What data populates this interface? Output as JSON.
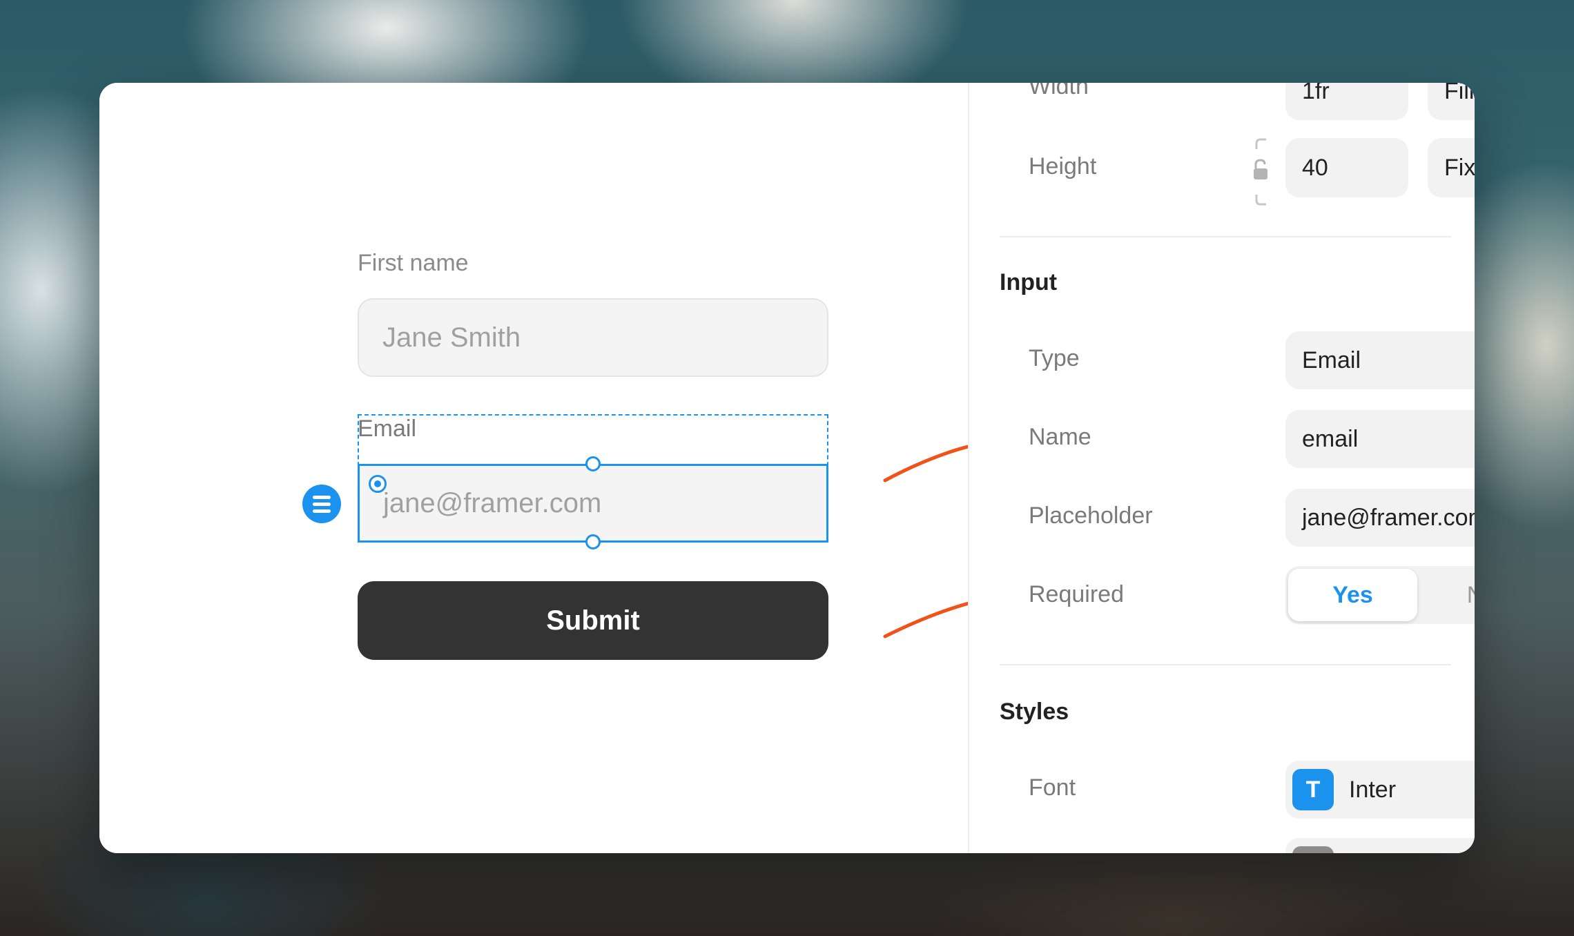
{
  "form": {
    "first_name_label": "First name",
    "first_name_placeholder": "Jane Smith",
    "email_label": "Email",
    "email_placeholder": "jane@framer.com",
    "submit_label": "Submit"
  },
  "panel": {
    "width_label": "Width",
    "width_value": "1fr",
    "width_mode": "Fill",
    "height_label": "Height",
    "height_value": "40",
    "height_mode": "Fixed",
    "input_section": {
      "title": "Input",
      "type_label": "Type",
      "type_value": "Email",
      "name_label": "Name",
      "name_value": "email",
      "placeholder_label": "Placeholder",
      "placeholder_value": "jane@framer.com",
      "required_label": "Required",
      "required_yes": "Yes",
      "required_no": "No",
      "required_selected": "Yes"
    },
    "styles_section": {
      "title": "Styles",
      "font_label": "Font",
      "font_badge": "T",
      "font_value": "Inter"
    }
  },
  "colors": {
    "accent": "#1b93ee",
    "annotation_arrow": "#f0521a",
    "submit_bg": "#333333"
  }
}
